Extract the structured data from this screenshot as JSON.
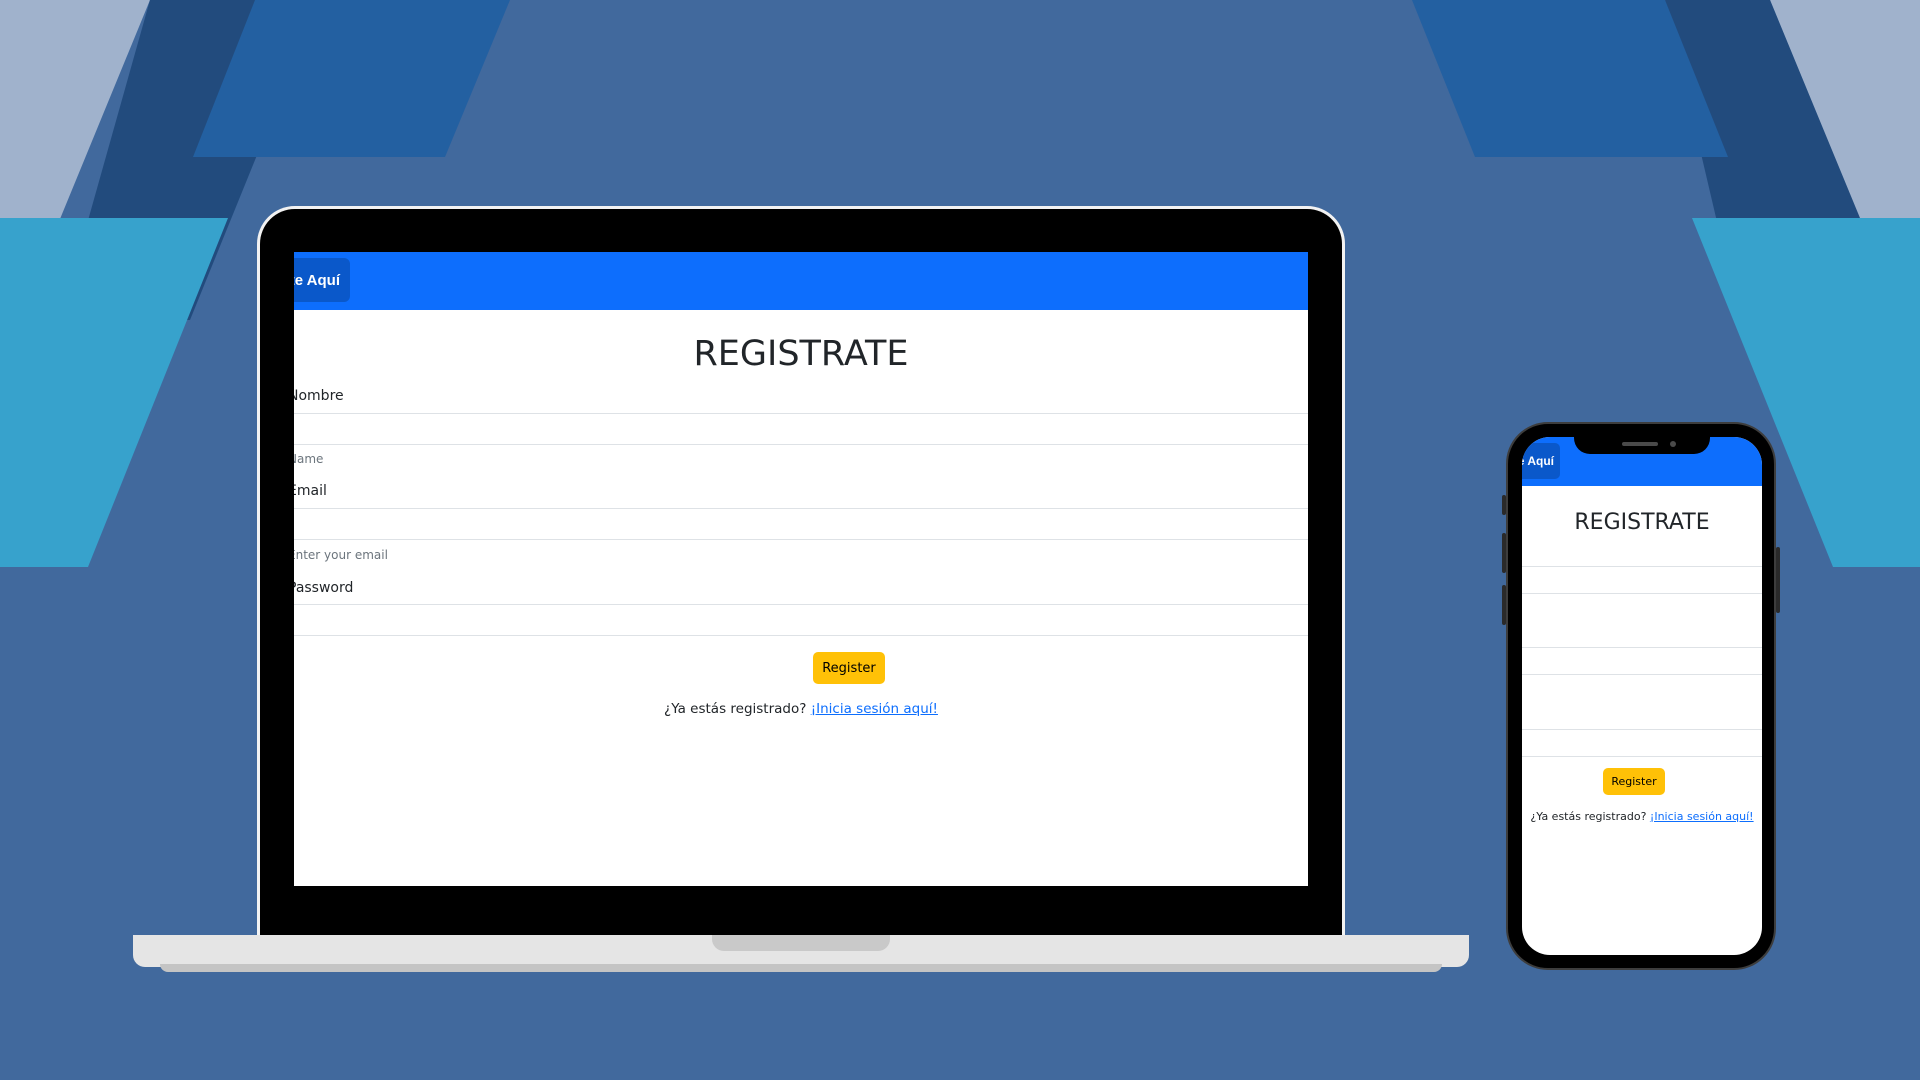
{
  "app": {
    "brand": "te Aquí",
    "title": "REGISTRATE",
    "fields": {
      "name": {
        "label": "Nombre",
        "placeholder": "",
        "help": "Name"
      },
      "email": {
        "label": "Email",
        "placeholder": "",
        "help": "Enter your email"
      },
      "password": {
        "label": "Password",
        "placeholder": ""
      }
    },
    "register_label": "Register",
    "login_prompt": "¿Ya estás registrado?",
    "login_link": "¡Inicia sesión aquí!"
  },
  "colors": {
    "background": "#41699d",
    "navbar": "#0d6efd",
    "brand_box": "#0a58ca",
    "register_button": "#ffc107",
    "link": "#0d6efd",
    "shape_light": "#a0b2cc",
    "shape_dark": "#224b7d",
    "shape_mid": "#2360a1",
    "shape_cyan": "#37a2cc"
  }
}
